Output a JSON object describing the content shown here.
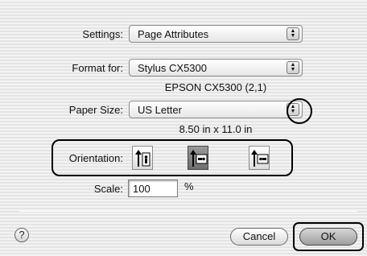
{
  "settings": {
    "label": "Settings:",
    "value": "Page Attributes"
  },
  "format_for": {
    "label": "Format for:",
    "value": "Stylus CX5300",
    "detail": "EPSON CX5300 (2,1)"
  },
  "paper_size": {
    "label": "Paper Size:",
    "value": "US Letter",
    "dimensions": "8.50 in x 11.0 in"
  },
  "orientation": {
    "label": "Orientation:",
    "options": [
      {
        "name": "portrait",
        "selected": false
      },
      {
        "name": "landscape",
        "selected": true
      },
      {
        "name": "reverse-landscape",
        "selected": false
      }
    ]
  },
  "scale": {
    "label": "Scale:",
    "value": "100",
    "unit": "%"
  },
  "buttons": {
    "help": "?",
    "cancel": "Cancel",
    "ok": "OK"
  },
  "icons": {
    "popup_arrows": "up-down-arrows-icon",
    "help": "question-icon"
  }
}
